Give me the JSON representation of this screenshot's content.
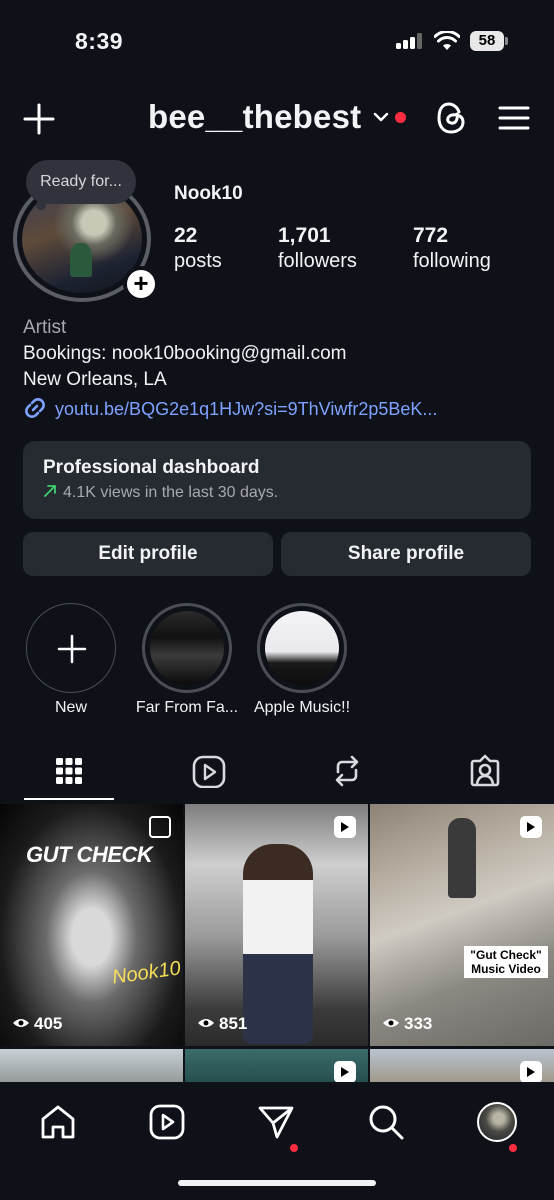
{
  "status_bar": {
    "time": "8:39",
    "battery": "58"
  },
  "header": {
    "username": "bee__thebest"
  },
  "profile": {
    "note": "Ready for...",
    "display_name": "Nook10",
    "stats": [
      {
        "value": "22",
        "label": "posts"
      },
      {
        "value": "1,701",
        "label": "followers"
      },
      {
        "value": "772",
        "label": "following"
      }
    ],
    "category": "Artist",
    "bio_lines": [
      "Bookings: nook10booking@gmail.com",
      "New Orleans, LA"
    ],
    "link": "youtu.be/BQG2e1q1HJw?si=9ThViwfr2p5BeK..."
  },
  "dashboard": {
    "title": "Professional dashboard",
    "subtitle": "4.1K views in the last 30 days."
  },
  "actions": {
    "edit": "Edit profile",
    "share": "Share profile"
  },
  "highlights": [
    {
      "label": "New"
    },
    {
      "label": "Far From Fa..."
    },
    {
      "label": "Apple Music!!"
    }
  ],
  "grid": [
    {
      "views": "405",
      "type": "multi",
      "overlay_title": "GUT CHECK",
      "overlay_sig": "Nook10"
    },
    {
      "views": "851",
      "type": "reel"
    },
    {
      "views": "333",
      "type": "reel",
      "caption": "\"Gut Check\" Music Video"
    }
  ],
  "colors": {
    "background": "#0e1118",
    "card": "#262a31",
    "link": "#7da2ff",
    "notification": "#ff2d3f"
  }
}
